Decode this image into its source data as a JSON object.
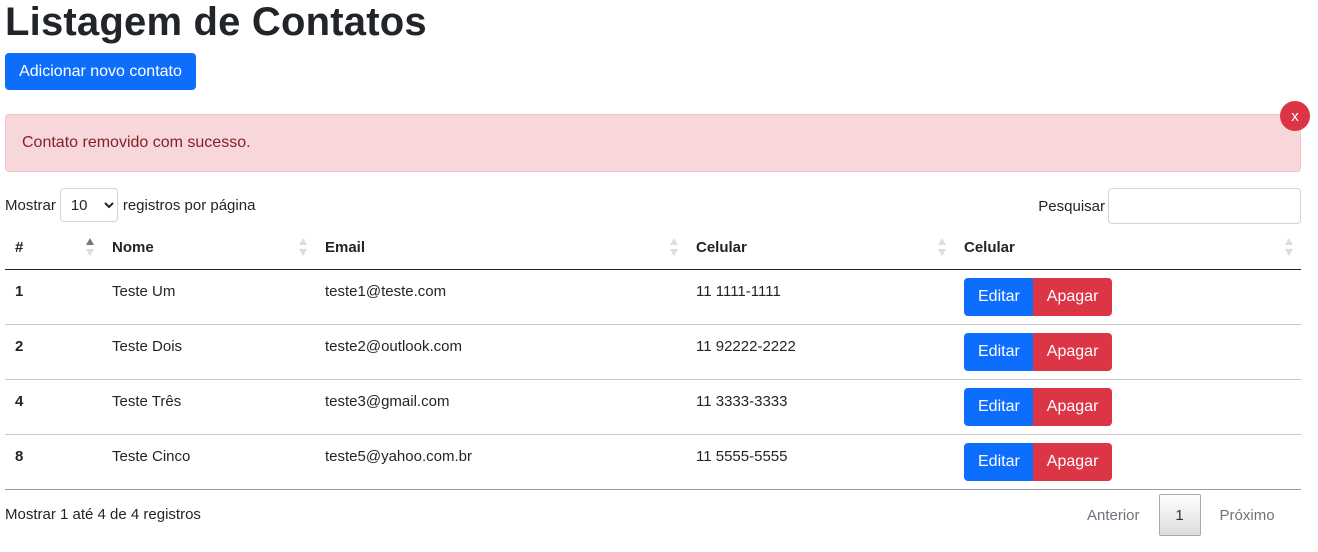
{
  "page": {
    "title": "Listagem de Contatos",
    "add_button": "Adicionar novo contato"
  },
  "alert": {
    "message": "Contato removido com sucesso.",
    "close_label": "x"
  },
  "length": {
    "prefix": "Mostrar",
    "selected": "10",
    "suffix": "registros por página"
  },
  "search": {
    "label": "Pesquisar",
    "value": ""
  },
  "table": {
    "columns": [
      "#",
      "Nome",
      "Email",
      "Celular",
      "Celular"
    ],
    "rows": [
      {
        "id": "1",
        "name": "Teste Um",
        "email": "teste1@teste.com",
        "phone": "11 1111-1111"
      },
      {
        "id": "2",
        "name": "Teste Dois",
        "email": "teste2@outlook.com",
        "phone": "11 92222-2222"
      },
      {
        "id": "4",
        "name": "Teste Três",
        "email": "teste3@gmail.com",
        "phone": "11 3333-3333"
      },
      {
        "id": "8",
        "name": "Teste Cinco",
        "email": "teste5@yahoo.com.br",
        "phone": "11 5555-5555"
      }
    ],
    "edit_label": "Editar",
    "delete_label": "Apagar"
  },
  "footer": {
    "info": "Mostrar 1 até 4 de 4 registros",
    "previous": "Anterior",
    "current_page": "1",
    "next": "Próximo"
  },
  "colors": {
    "primary": "#0d6efd",
    "danger": "#dc3545",
    "alert_bg": "#f8d7da",
    "alert_text": "#842029"
  }
}
